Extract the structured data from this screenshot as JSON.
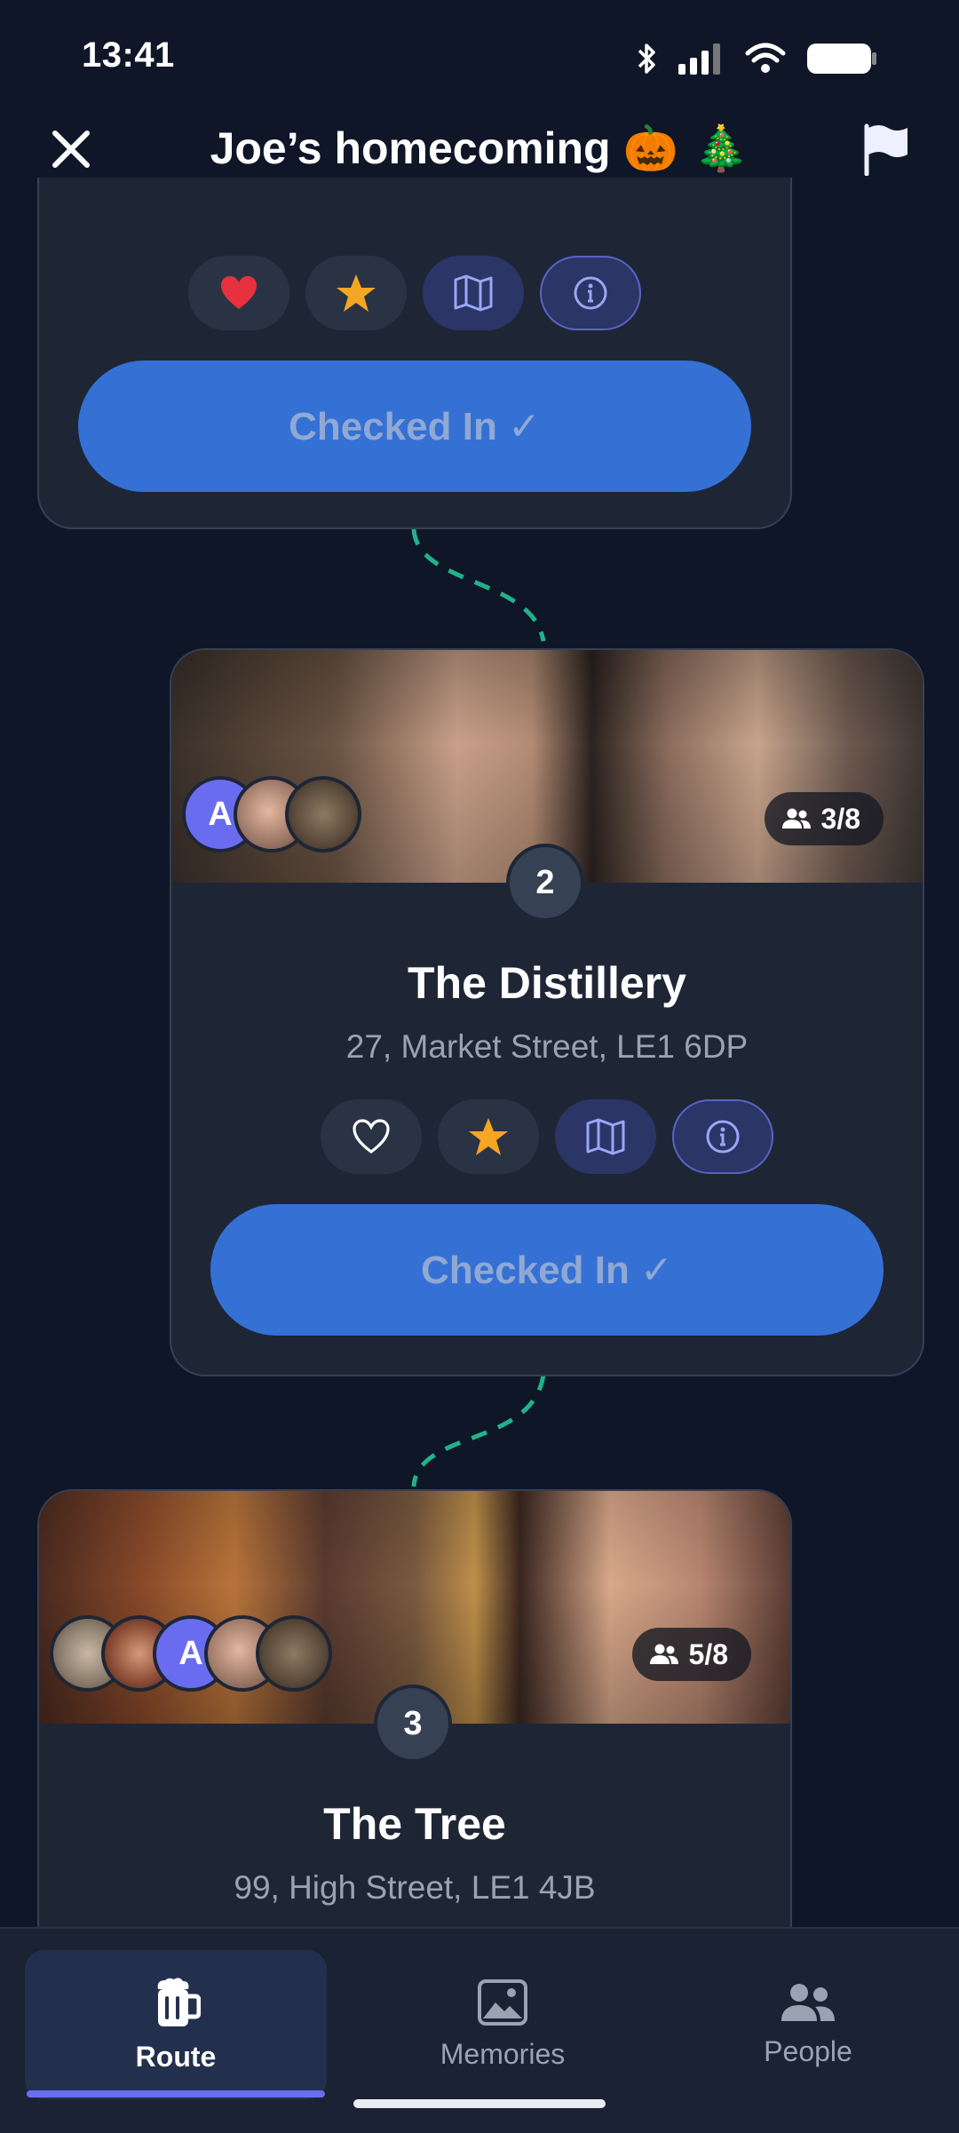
{
  "status_bar": {
    "time": "13:41"
  },
  "header": {
    "title": "Joe’s homecoming",
    "emoji": "🎃 🎄"
  },
  "stops": [
    {
      "checkin_label": "Checked In ✓",
      "favorited": true,
      "icons": [
        "heart-filled-icon",
        "star-icon",
        "map-icon",
        "info-icon"
      ]
    },
    {
      "number": "2",
      "name": "The Distillery",
      "address": "27, Market Street, LE1 6DP",
      "attendance": "3/8",
      "avatars": [
        "A",
        "photo",
        "photo"
      ],
      "checkin_label": "Checked In ✓",
      "favorited": false,
      "icons": [
        "heart-outline-icon",
        "star-icon",
        "map-icon",
        "info-icon"
      ]
    },
    {
      "number": "3",
      "name": "The Tree",
      "address": "99, High Street, LE1 4JB",
      "attendance": "5/8",
      "avatars": [
        "photo",
        "photo",
        "A",
        "photo",
        "photo"
      ]
    }
  ],
  "bottom_nav": {
    "items": [
      {
        "label": "Route",
        "icon": "beer-mug-icon",
        "active": true
      },
      {
        "label": "Memories",
        "icon": "image-icon",
        "active": false
      },
      {
        "label": "People",
        "icon": "people-icon",
        "active": false
      }
    ]
  },
  "colors": {
    "background": "#0f1627",
    "card": "#1e2636",
    "primary_button": "#3570d4",
    "accent": "#6a6cf0",
    "route_line": "#21b28a",
    "star": "#f5a623",
    "heart": "#e5323e"
  }
}
